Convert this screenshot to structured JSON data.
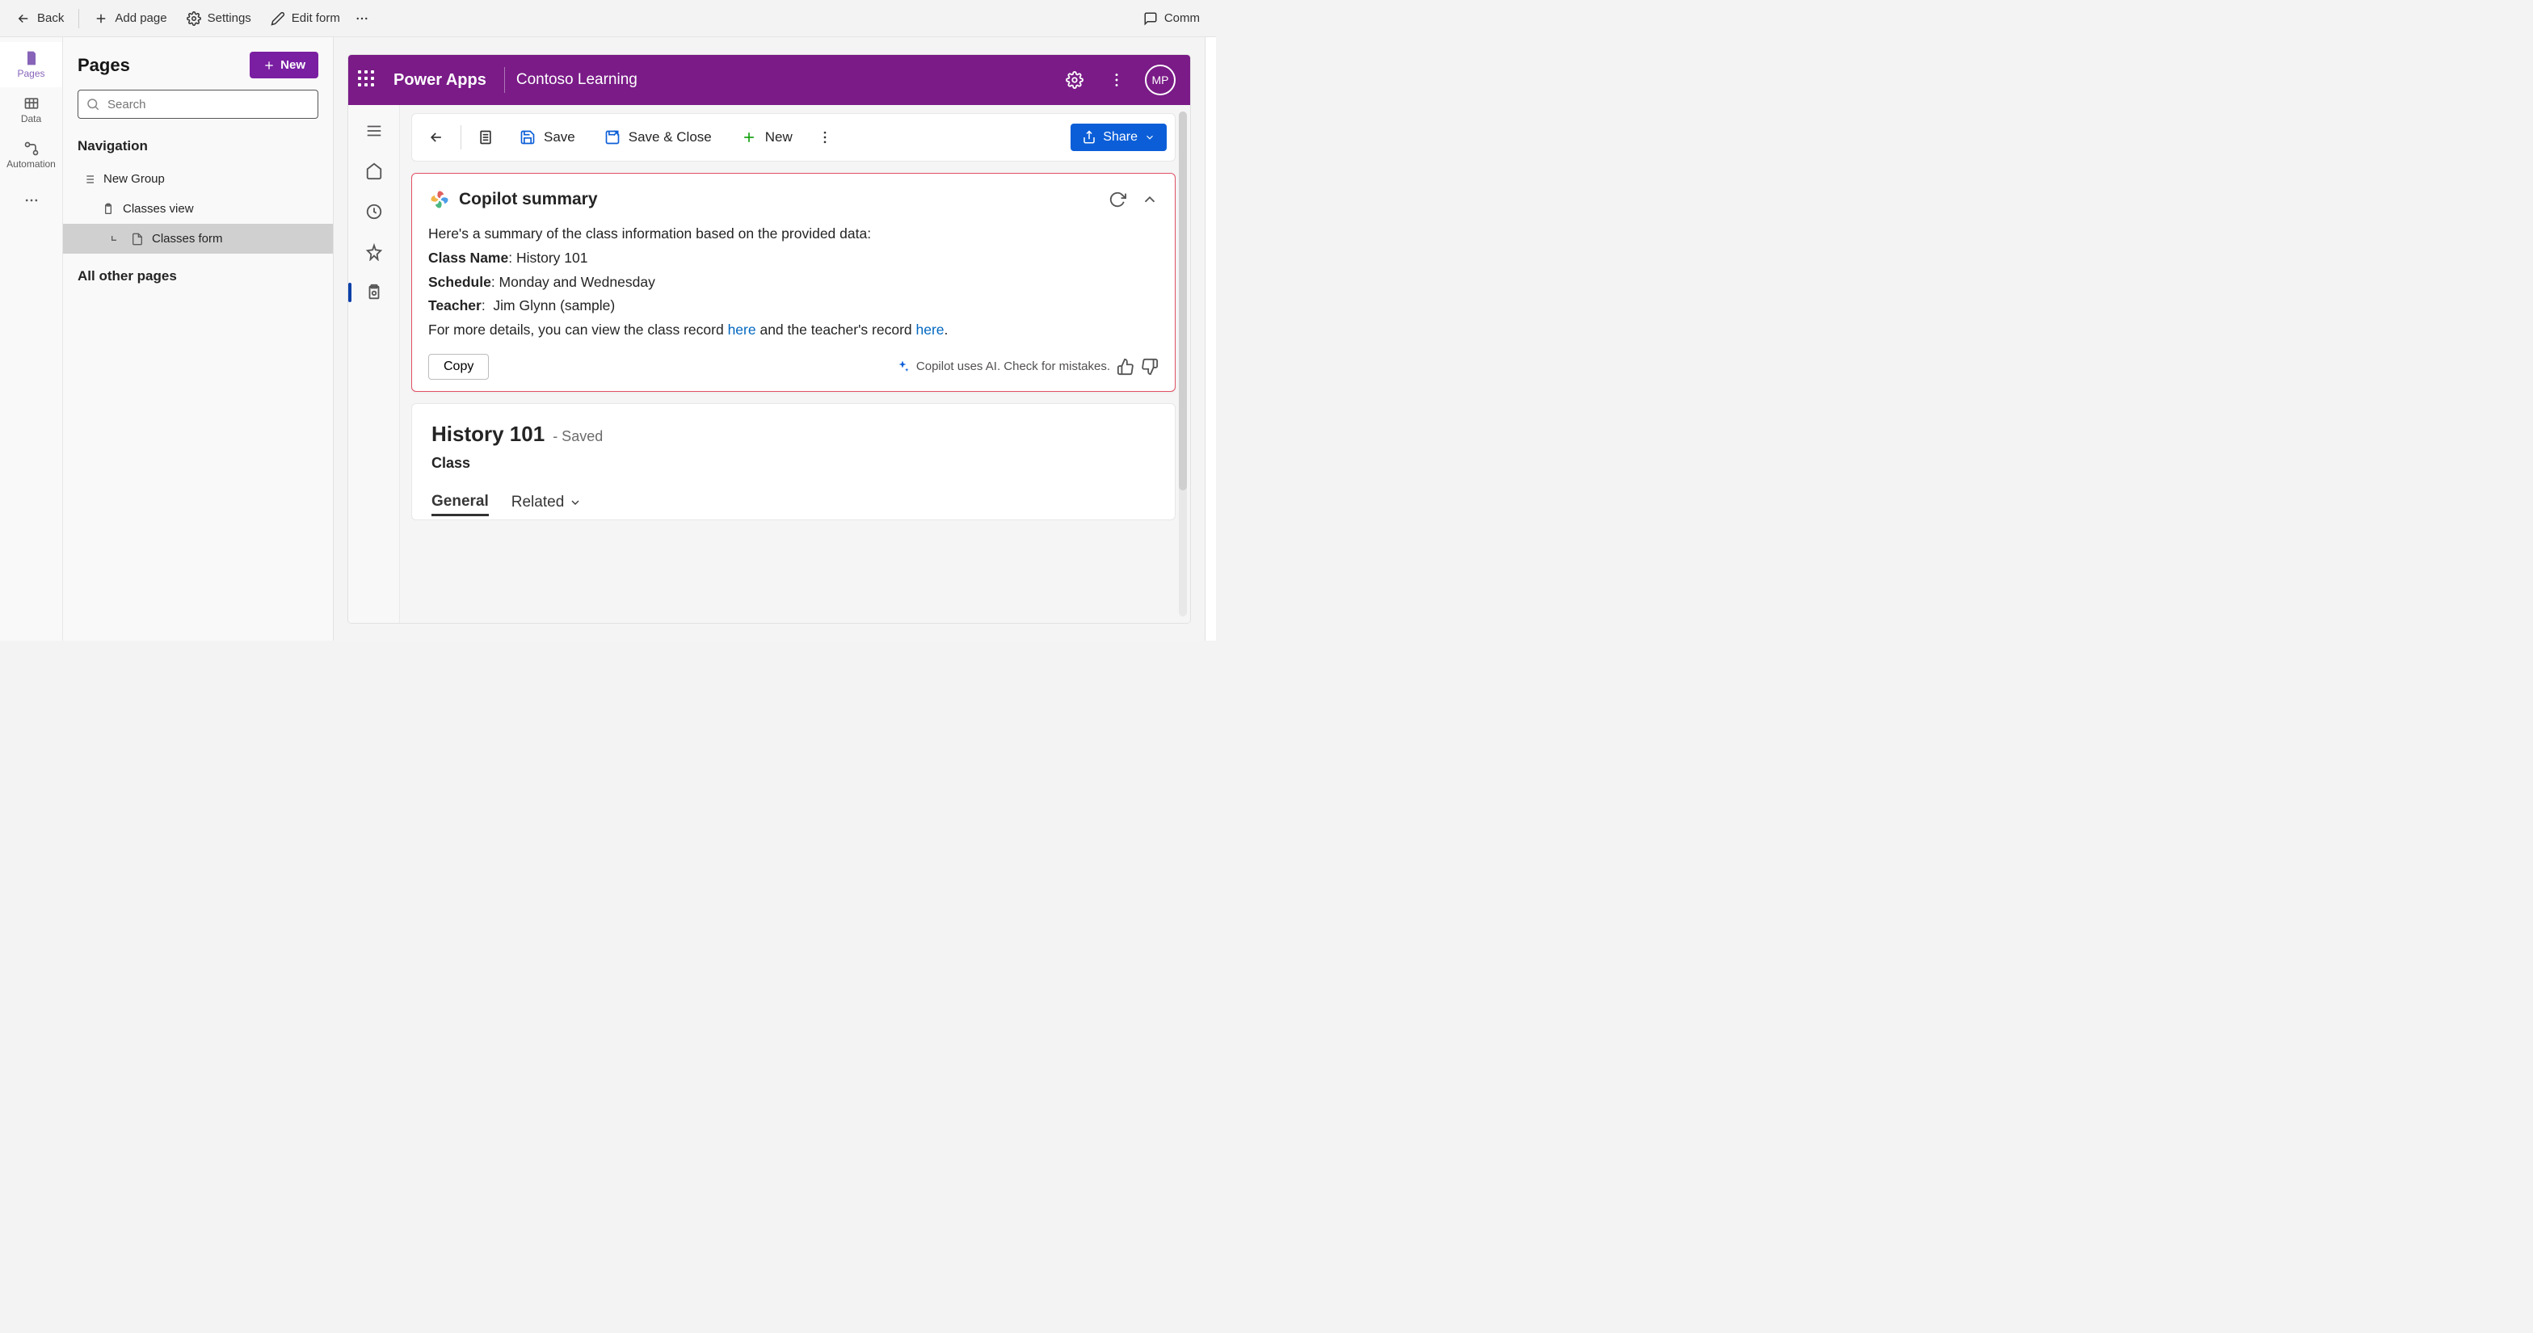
{
  "topbar": {
    "back": "Back",
    "add_page": "Add page",
    "settings": "Settings",
    "edit_form": "Edit form",
    "comments": "Comm"
  },
  "rail": {
    "pages": "Pages",
    "data": "Data",
    "automation": "Automation"
  },
  "pages_panel": {
    "title": "Pages",
    "new_btn": "New",
    "search_placeholder": "Search",
    "navigation_header": "Navigation",
    "group": "New Group",
    "item_classes_view": "Classes view",
    "item_classes_form": "Classes form",
    "other_pages": "All other pages"
  },
  "preview": {
    "appbar": {
      "product": "Power Apps",
      "env": "Contoso Learning",
      "avatar": "MP"
    },
    "cmdbar": {
      "save": "Save",
      "save_close": "Save & Close",
      "new": "New",
      "share": "Share"
    },
    "copilot": {
      "title": "Copilot summary",
      "intro": "Here's a summary of the class information based on the provided data:",
      "class_name_label": "Class Name",
      "class_name_value": "History 101",
      "schedule_label": "Schedule",
      "schedule_value": "Monday and Wednesday",
      "teacher_label": "Teacher",
      "teacher_value": "Jim Glynn (sample)",
      "more_a": "For more details, you can view the class record ",
      "more_b": " and the teacher's record ",
      "here": "here",
      "copy": "Copy",
      "ai_note": "Copilot uses AI. Check for mistakes."
    },
    "record": {
      "title": "History 101",
      "saved": "- Saved",
      "entity": "Class",
      "tab_general": "General",
      "tab_related": "Related"
    }
  }
}
